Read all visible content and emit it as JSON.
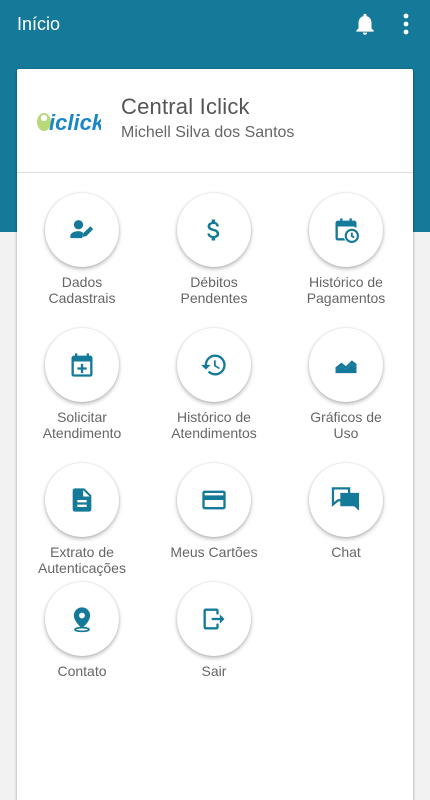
{
  "appbar": {
    "title": "Início",
    "actions": [
      "bell-icon",
      "more-vert-icon"
    ]
  },
  "header": {
    "logo_text": "iclick",
    "title": "Central Iclick",
    "subtitle": "Michell Silva dos Santos"
  },
  "colors": {
    "primary": "#157a99",
    "icon": "#157a99",
    "text": "#666666"
  },
  "menu": [
    {
      "label": "Dados\nCadastrais",
      "icon": "person-edit-icon"
    },
    {
      "label": "Débitos\nPendentes",
      "icon": "dollar-icon"
    },
    {
      "label": "Histórico de\nPagamentos",
      "icon": "calendar-clock-icon"
    },
    {
      "label": "Solicitar\nAtendimento",
      "icon": "calendar-add-icon"
    },
    {
      "label": "Histórico de\nAtendimentos",
      "icon": "history-icon"
    },
    {
      "label": "Gráficos de\nUso",
      "icon": "area-chart-icon"
    },
    {
      "label": "Extrato de\nAutenticações",
      "icon": "document-icon"
    },
    {
      "label": "Meus Cartões",
      "icon": "credit-card-icon"
    },
    {
      "label": "Chat",
      "icon": "chat-icon"
    },
    {
      "label": "Contato",
      "icon": "location-pin-icon"
    },
    {
      "label": "Sair",
      "icon": "logout-icon"
    }
  ]
}
